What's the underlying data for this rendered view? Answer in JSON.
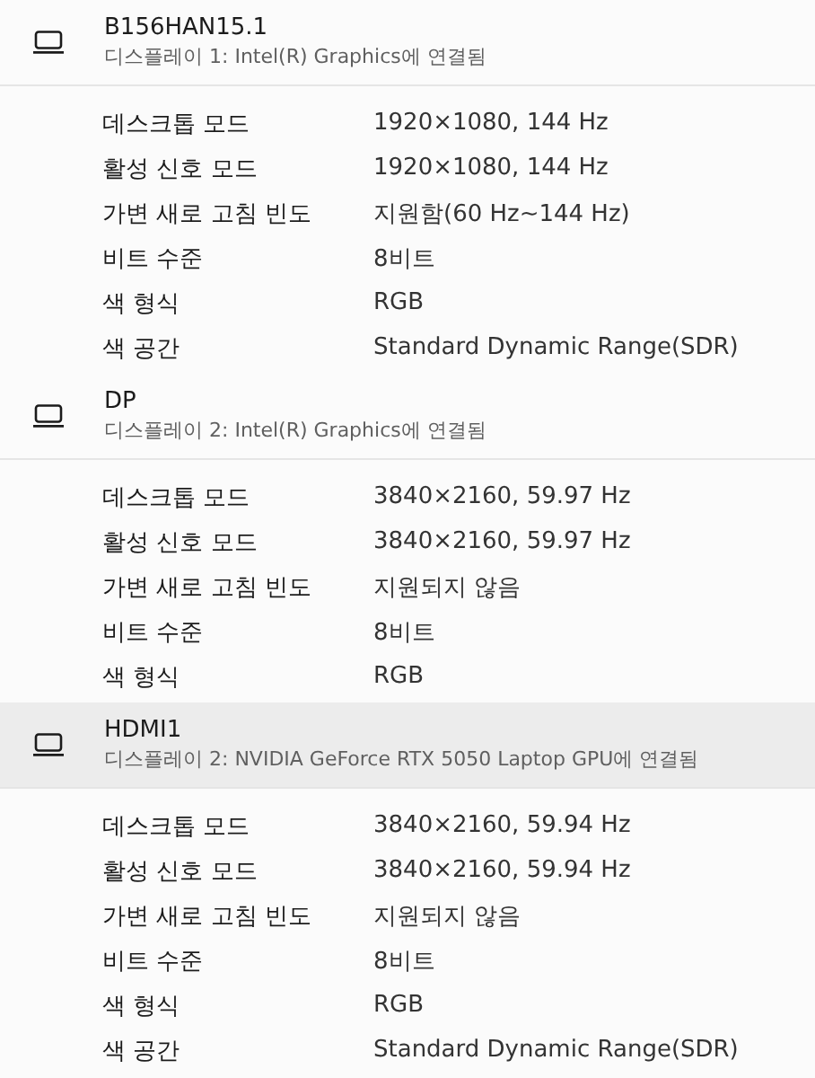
{
  "displays": [
    {
      "name": "B156HAN15.1",
      "connection": "디스플레이 1: Intel(R) Graphics에 연결됨",
      "hovered": false,
      "properties": [
        {
          "label": "데스크톱 모드",
          "value": "1920×1080, 144 Hz"
        },
        {
          "label": "활성 신호 모드",
          "value": "1920×1080, 144 Hz"
        },
        {
          "label": "가변 새로 고침 빈도",
          "value": "지원함(60 Hz~144 Hz)"
        },
        {
          "label": "비트 수준",
          "value": "8비트"
        },
        {
          "label": "색 형식",
          "value": "RGB"
        },
        {
          "label": "색 공간",
          "value": "Standard Dynamic Range(SDR)"
        }
      ]
    },
    {
      "name": "DP",
      "connection": "디스플레이 2: Intel(R) Graphics에 연결됨",
      "hovered": false,
      "properties": [
        {
          "label": "데스크톱 모드",
          "value": "3840×2160, 59.97 Hz"
        },
        {
          "label": "활성 신호 모드",
          "value": "3840×2160, 59.97 Hz"
        },
        {
          "label": "가변 새로 고침 빈도",
          "value": "지원되지 않음"
        },
        {
          "label": "비트 수준",
          "value": "8비트"
        },
        {
          "label": "색 형식",
          "value": "RGB"
        }
      ]
    },
    {
      "name": "HDMI1",
      "connection": "디스플레이 2: NVIDIA GeForce RTX 5050 Laptop GPU에 연결됨",
      "hovered": true,
      "properties": [
        {
          "label": "데스크톱 모드",
          "value": "3840×2160, 59.94 Hz"
        },
        {
          "label": "활성 신호 모드",
          "value": "3840×2160, 59.94 Hz"
        },
        {
          "label": "가변 새로 고침 빈도",
          "value": "지원되지 않음"
        },
        {
          "label": "비트 수준",
          "value": "8비트"
        },
        {
          "label": "색 형식",
          "value": "RGB"
        },
        {
          "label": "색 공간",
          "value": "Standard Dynamic Range(SDR)"
        }
      ]
    }
  ]
}
